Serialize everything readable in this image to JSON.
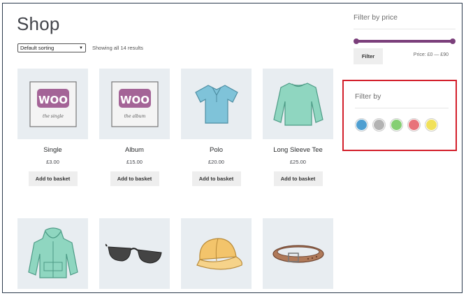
{
  "page": {
    "title": "Shop"
  },
  "toolbar": {
    "sort_value": "Default sorting",
    "result_count": "Showing all 14 results"
  },
  "products": [
    {
      "name": "Single",
      "price": "£3.00",
      "button": "Add to basket",
      "icon": "woo-single-image"
    },
    {
      "name": "Album",
      "price": "£15.00",
      "button": "Add to basket",
      "icon": "woo-album-image"
    },
    {
      "name": "Polo",
      "price": "£20.00",
      "button": "Add to basket",
      "icon": "polo-shirt-image"
    },
    {
      "name": "Long Sleeve Tee",
      "price": "£25.00",
      "button": "Add to basket",
      "icon": "long-sleeve-tee-image"
    },
    {
      "icon": "hoodie-image"
    },
    {
      "icon": "sunglasses-image"
    },
    {
      "icon": "cap-image"
    },
    {
      "icon": "belt-image"
    }
  ],
  "sidebar": {
    "price_filter": {
      "title": "Filter by price",
      "button": "Filter",
      "range_label": "Price: £0 — £90",
      "slider_color": "#7b3f7b"
    },
    "attribute_filter": {
      "title": "Filter by",
      "highlight_color": "#d31f2b",
      "swatches": [
        {
          "name": "blue",
          "color": "#4f9fd1"
        },
        {
          "name": "gray",
          "color": "#b3b3b3"
        },
        {
          "name": "green",
          "color": "#85cf73"
        },
        {
          "name": "red",
          "color": "#e8727a"
        },
        {
          "name": "yellow",
          "color": "#f1e15a"
        }
      ]
    }
  },
  "woo_logo": {
    "word": "WOO",
    "single_caption": "the single",
    "album_caption": "the album"
  }
}
